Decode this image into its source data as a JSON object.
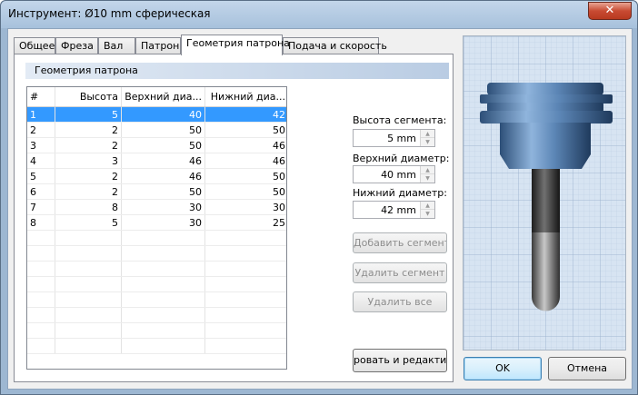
{
  "window": {
    "title": "Инструмент: Ø10 mm сферическая",
    "close_label": "✕"
  },
  "tabs": [
    {
      "label": "Общее"
    },
    {
      "label": "Фреза"
    },
    {
      "label": "Вал"
    },
    {
      "label": "Патрон"
    },
    {
      "label": "Геометрия патрона",
      "active": true
    },
    {
      "label": "Подача и скорость"
    }
  ],
  "section_header": "Геометрия патрона",
  "table": {
    "columns": [
      "#",
      "Высота",
      "Верхний диа...",
      "Нижний диа..."
    ],
    "rows": [
      [
        "1",
        "5",
        "40",
        "42"
      ],
      [
        "2",
        "2",
        "50",
        "50"
      ],
      [
        "3",
        "2",
        "50",
        "46"
      ],
      [
        "4",
        "3",
        "46",
        "46"
      ],
      [
        "5",
        "2",
        "46",
        "50"
      ],
      [
        "6",
        "2",
        "50",
        "50"
      ],
      [
        "7",
        "8",
        "30",
        "30"
      ],
      [
        "8",
        "5",
        "30",
        "25"
      ]
    ],
    "selected_row": 0
  },
  "fields": {
    "segment_height": {
      "label": "Высота сегмента:",
      "value": "5 mm"
    },
    "top_diameter": {
      "label": "Верхний диаметр:",
      "value": "40 mm"
    },
    "bottom_diameter": {
      "label": "Нижний диаметр:",
      "value": "42 mm"
    }
  },
  "buttons": {
    "add_segment": "Добавить сегмент",
    "delete_segment": "Удалить сегмент",
    "delete_all": "Удалить все",
    "edit": "ровать и редактиро",
    "ok": "OK",
    "cancel": "Отмена"
  },
  "icons": {
    "spin_up": "▲",
    "spin_down": "▼"
  },
  "colors": {
    "selection": "#3399ff",
    "preview_grid": "#d7e4f2",
    "holder_blue": "#5c86b6"
  }
}
